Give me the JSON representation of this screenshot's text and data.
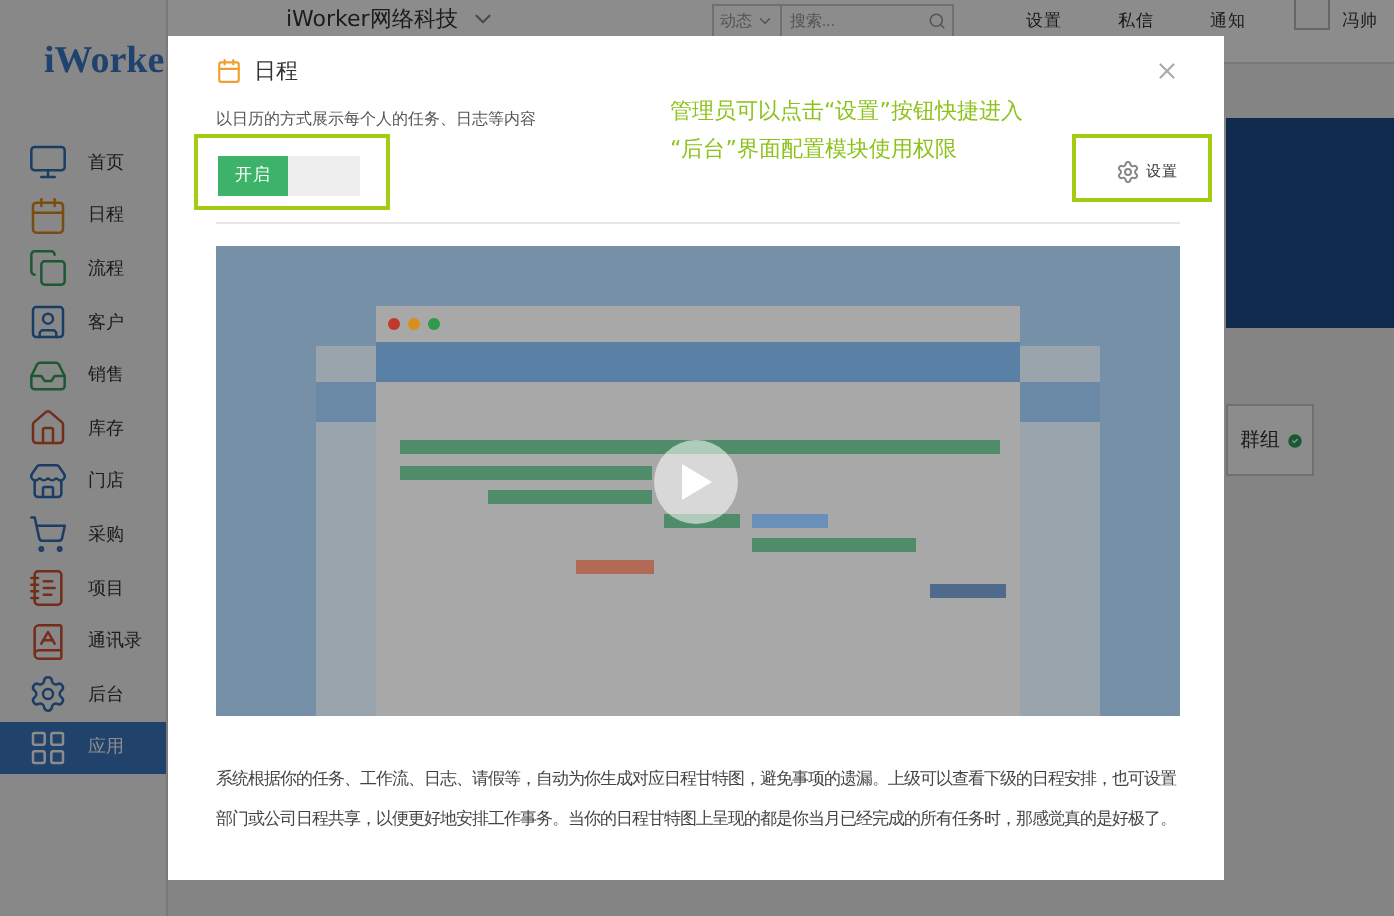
{
  "app": {
    "logo": "iWorke",
    "company": "iWorker网络科技",
    "search": {
      "filter": "动态",
      "placeholder": "搜索..."
    },
    "links": [
      "设置",
      "私信",
      "通知"
    ],
    "user": "冯帅"
  },
  "sidebar": {
    "items": [
      {
        "label": "首页",
        "selected": false
      },
      {
        "label": "日程",
        "selected": false
      },
      {
        "label": "流程",
        "selected": false
      },
      {
        "label": "客户",
        "selected": false
      },
      {
        "label": "销售",
        "selected": false
      },
      {
        "label": "库存",
        "selected": false
      },
      {
        "label": "门店",
        "selected": false
      },
      {
        "label": "采购",
        "selected": false
      },
      {
        "label": "项目",
        "selected": false
      },
      {
        "label": "通讯录",
        "selected": false
      },
      {
        "label": "后台",
        "selected": false
      },
      {
        "label": "应用",
        "selected": true
      }
    ]
  },
  "background": {
    "card": {
      "label": "群组"
    }
  },
  "dialog": {
    "title": "日程",
    "description": "以日历的方式展示每个人的任务、日志等内容",
    "switch": {
      "label": "开启",
      "on": true
    },
    "settings_button": "设置",
    "annotation": [
      "管理员可以点击“设置”按钮快捷进入",
      "“后台”界面配置模块使用权限"
    ],
    "video": {
      "kind": "picture"
    },
    "body": "系统根据你的任务、工作流、日志、请假等，自动为你生成对应日程甘特图，避免事项的遗漏。上级可以查看下级的日程安排，也可设置部门或公司日程共享，以便更好地安排工作事务。当你的日程甘特图上呈现的都是你当月已经完成的所有任务时，那感觉真的是好极了。"
  }
}
